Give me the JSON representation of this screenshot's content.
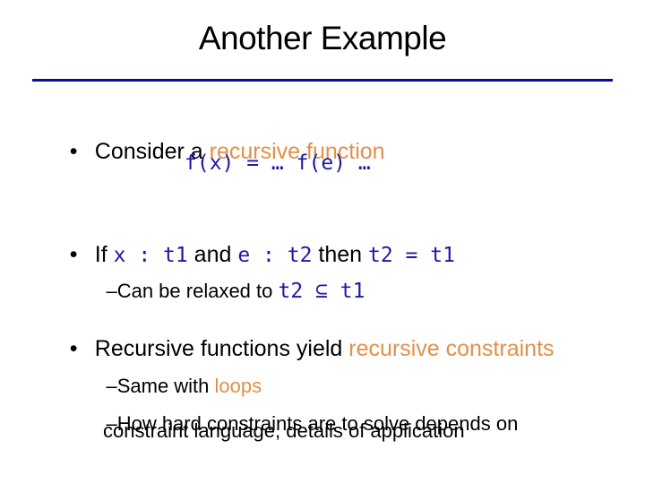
{
  "slide": {
    "title": "Another Example",
    "colors": {
      "rule": "#0a0aa0",
      "code": "#1a1aa6",
      "accent": "#e0904a"
    },
    "bullets": [
      {
        "marker": "•",
        "text_a": "Consider a ",
        "accent": "recursive function",
        "code_line": "f(x) = … f(e) …"
      },
      {
        "marker": "•",
        "if": "If ",
        "code1": "x : t1",
        "and": " and ",
        "code2": "e : t2",
        "then": " then ",
        "code3": "t2 = t1",
        "sub": {
          "marker": "–",
          "text": "Can be relaxed to ",
          "code": "t2 ⊆ t1"
        }
      },
      {
        "marker": "•",
        "text_a": "Recursive functions yield ",
        "accent": "recursive constraints",
        "subs": [
          {
            "marker": "–",
            "text": "Same with ",
            "accent": "loops"
          },
          {
            "marker": "–",
            "text": "How hard constraints are to solve depends on",
            "continuation": "constraint language, details of application"
          }
        ]
      }
    ]
  }
}
